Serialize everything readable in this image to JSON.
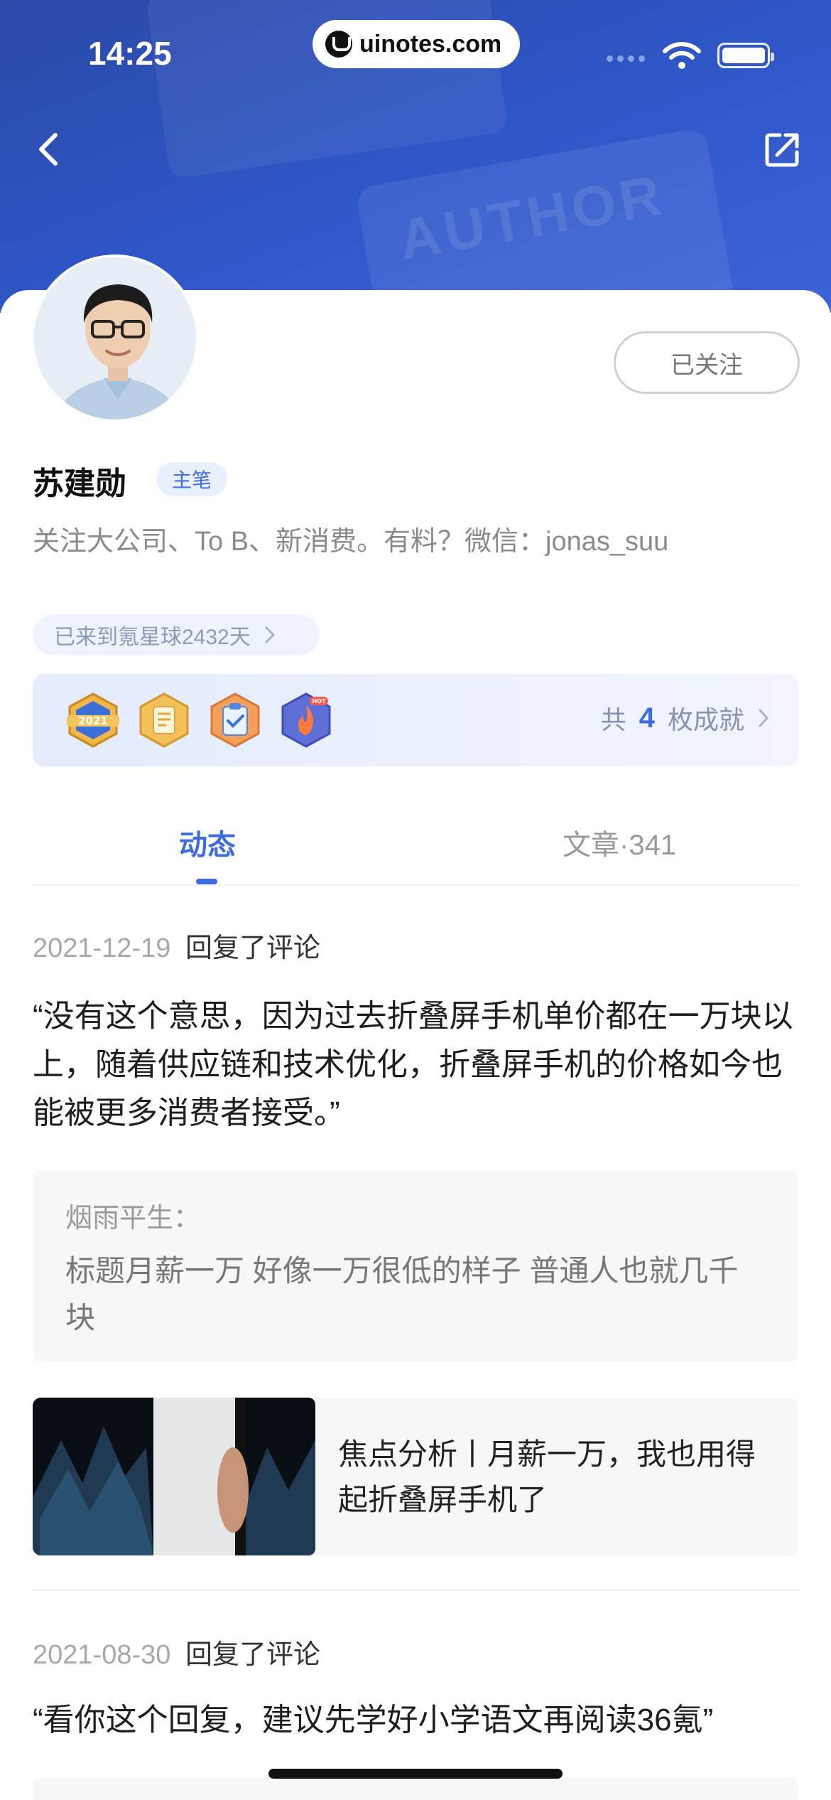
{
  "status_bar": {
    "time": "14:25",
    "url": "uinotes.com"
  },
  "icons": {
    "back": "chevron-left-icon",
    "share": "share-external-icon",
    "wifi": "wifi-icon",
    "battery": "battery-icon"
  },
  "hero": {
    "watermark": "AUTHOR"
  },
  "profile": {
    "name": "苏建勋",
    "role_badge": "主笔",
    "bio": "关注大公司、To B、新消费。有料？微信：jonas_suu",
    "follow_label": "已关注",
    "days_label": "已来到氪星球2432天"
  },
  "achievements": {
    "prefix": "共",
    "count": "4",
    "suffix": "枚成就",
    "badges": [
      "badge-2021-icon",
      "badge-document-icon",
      "badge-clipboard-icon",
      "badge-hot-fire-icon"
    ],
    "badge_2021_text": "2021",
    "badge_hot_text": "HOT"
  },
  "tabs": [
    {
      "label": "动态",
      "active": true
    },
    {
      "label": "文章·341",
      "active": false
    }
  ],
  "feed": [
    {
      "date": "2021-12-19",
      "action": "回复了评论",
      "quote": "“没有这个意思，因为过去折叠屏手机单价都在一万块以上，随着供应链和技术优化，折叠屏手机的价格如今也能被更多消费者接受。”",
      "comment_author": "烟雨平生：",
      "comment_text": "标题月薪一万 好像一万很低的样子 普通人也就几千块",
      "article_title": "焦点分析丨月薪一万，我也用得起折叠屏手机了"
    },
    {
      "date": "2021-08-30",
      "action": "回复了评论",
      "quote": "“看你这个回复，建议先学好小学语文再阅读36氪”"
    }
  ],
  "colors": {
    "accent": "#3d6be0",
    "hero_blue": "#2f57c9",
    "muted_text": "#8a8a8a",
    "card_bg": "#f7f7f7"
  }
}
